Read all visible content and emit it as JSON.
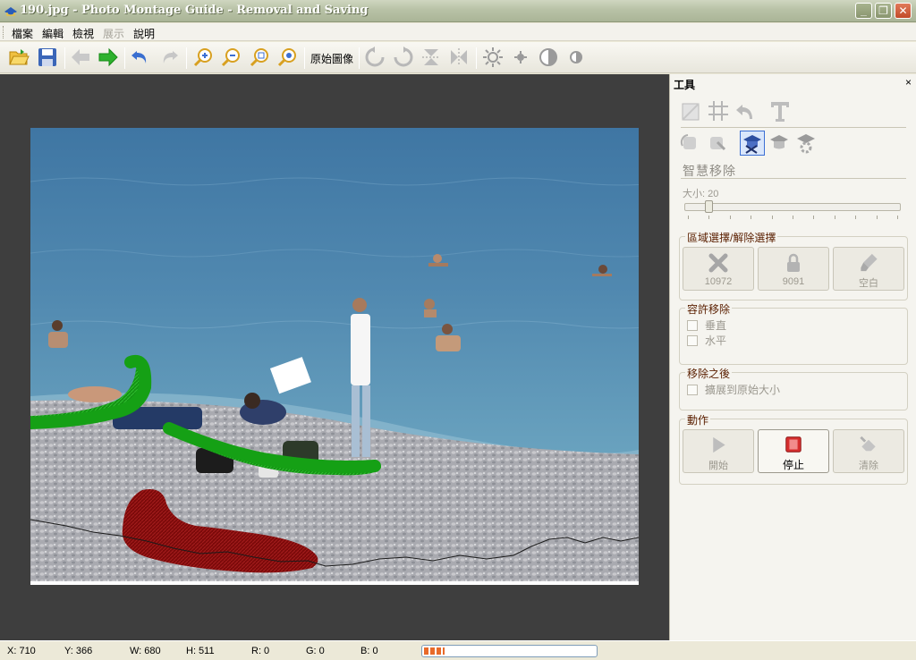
{
  "window": {
    "title": "190.jpg - Photo Montage Guide - Removal and Saving",
    "minimize_glyph": "_",
    "restore_glyph": "❐",
    "close_glyph": "✕"
  },
  "menu": [
    {
      "label": "檔案",
      "enabled": true
    },
    {
      "label": "編輯",
      "enabled": true
    },
    {
      "label": "檢視",
      "enabled": true
    },
    {
      "label": "展示",
      "enabled": false
    },
    {
      "label": "說明",
      "enabled": true
    }
  ],
  "toolbar": {
    "icons": [
      "open-folder-icon",
      "save-disk-icon",
      "back-arrow-icon",
      "forward-arrow-icon",
      "undo-icon",
      "redo-icon",
      "zoom-in-icon",
      "zoom-out-icon",
      "zoom-fit-icon",
      "zoom-actual-icon",
      "rotate-left-icon",
      "rotate-right-icon",
      "flip-vertical-icon",
      "flip-horizontal-icon",
      "brightness-icon",
      "sharpen-icon",
      "contrast-icon",
      "saturation-icon"
    ],
    "original_image_label": "原始圖像"
  },
  "panel": {
    "title": "工具",
    "close_glyph": "×",
    "tools_row1": [
      "crop-icon",
      "grid-icon",
      "revert-icon",
      "text-T-icon"
    ],
    "tools_row2": [
      "restore-left-icon",
      "restore-right-icon",
      "smart-removal-icon",
      "cap-icon",
      "gear-cap-icon"
    ],
    "section_heading": "智慧移除",
    "size_label": "大小: 20",
    "size_value": 20,
    "size_range": [
      1,
      200
    ],
    "selection_group": {
      "title": "區域選擇/解除選擇",
      "buttons": [
        {
          "label": "10972",
          "icon": "remove-x-icon"
        },
        {
          "label": "9091",
          "icon": "lock-icon"
        },
        {
          "label": "空白",
          "icon": "eraser-brush-icon"
        }
      ]
    },
    "allow_group": {
      "title": "容許移除",
      "options": [
        {
          "label": "垂直",
          "checked": false
        },
        {
          "label": "水平",
          "checked": false
        }
      ]
    },
    "after_group": {
      "title": "移除之後",
      "options": [
        {
          "label": "擴展到原始大小",
          "checked": false
        }
      ]
    },
    "action_group": {
      "title": "動作",
      "buttons": [
        {
          "label": "開始",
          "icon": "play-icon",
          "enabled": false
        },
        {
          "label": "停止",
          "icon": "stop-icon",
          "enabled": true
        },
        {
          "label": "清除",
          "icon": "clear-eraser-icon",
          "enabled": false
        }
      ]
    }
  },
  "status": {
    "x": "X: 710",
    "y": "Y: 366",
    "w": "W: 680",
    "h": "H: 511",
    "r": "R: 0",
    "g": "G: 0",
    "b": "B: 0",
    "progress_fraction": 0.12
  },
  "colors": {
    "keep_mask": "#1a9a1a",
    "remove_mask": "#8b0f0f",
    "workspace_bg": "#3e3e3e",
    "sea": "#4f83a8"
  }
}
